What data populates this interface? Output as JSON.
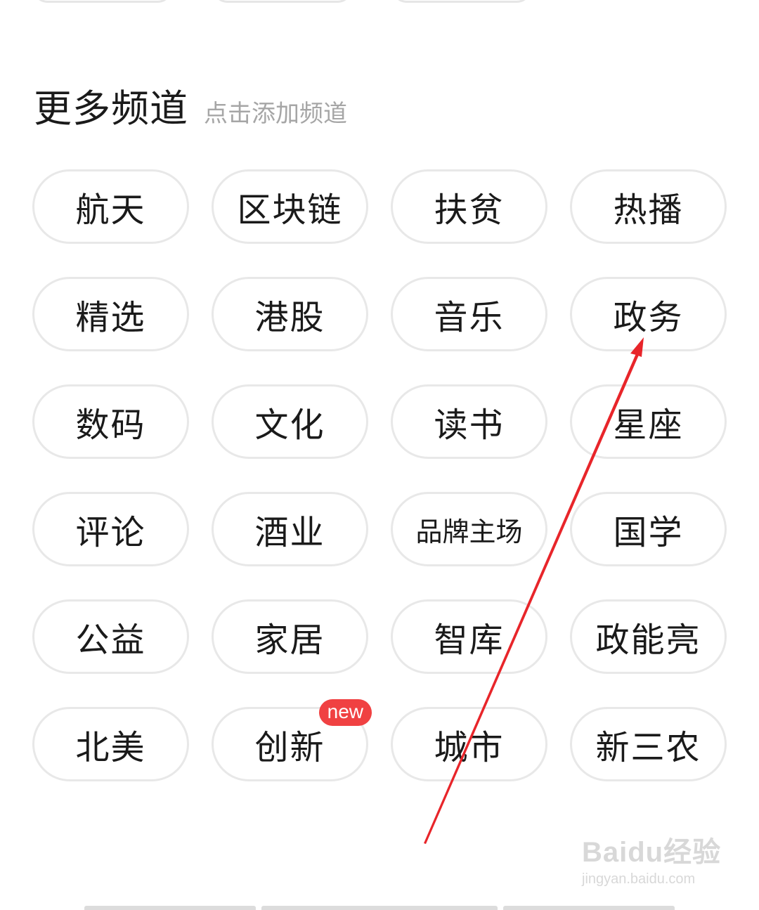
{
  "section": {
    "title": "更多频道",
    "hint": "点击添加频道"
  },
  "channels": [
    {
      "label": "航天"
    },
    {
      "label": "区块链"
    },
    {
      "label": "扶贫"
    },
    {
      "label": "热播"
    },
    {
      "label": "精选"
    },
    {
      "label": "港股"
    },
    {
      "label": "音乐"
    },
    {
      "label": "政务"
    },
    {
      "label": "数码"
    },
    {
      "label": "文化"
    },
    {
      "label": "读书"
    },
    {
      "label": "星座"
    },
    {
      "label": "评论"
    },
    {
      "label": "酒业"
    },
    {
      "label": "品牌主场"
    },
    {
      "label": "国学"
    },
    {
      "label": "公益"
    },
    {
      "label": "家居"
    },
    {
      "label": "智库"
    },
    {
      "label": "政能亮"
    },
    {
      "label": "北美"
    },
    {
      "label": "创新",
      "badge": "new"
    },
    {
      "label": "城市"
    },
    {
      "label": "新三农"
    }
  ],
  "watermark": {
    "main": "Baidu经验",
    "sub": "jingyan.baidu.com"
  },
  "colors": {
    "badge": "#f04142",
    "annotation_arrow": "#e8252a",
    "chip_border": "#e8e8e8",
    "hint_text": "#a6a6a6"
  }
}
